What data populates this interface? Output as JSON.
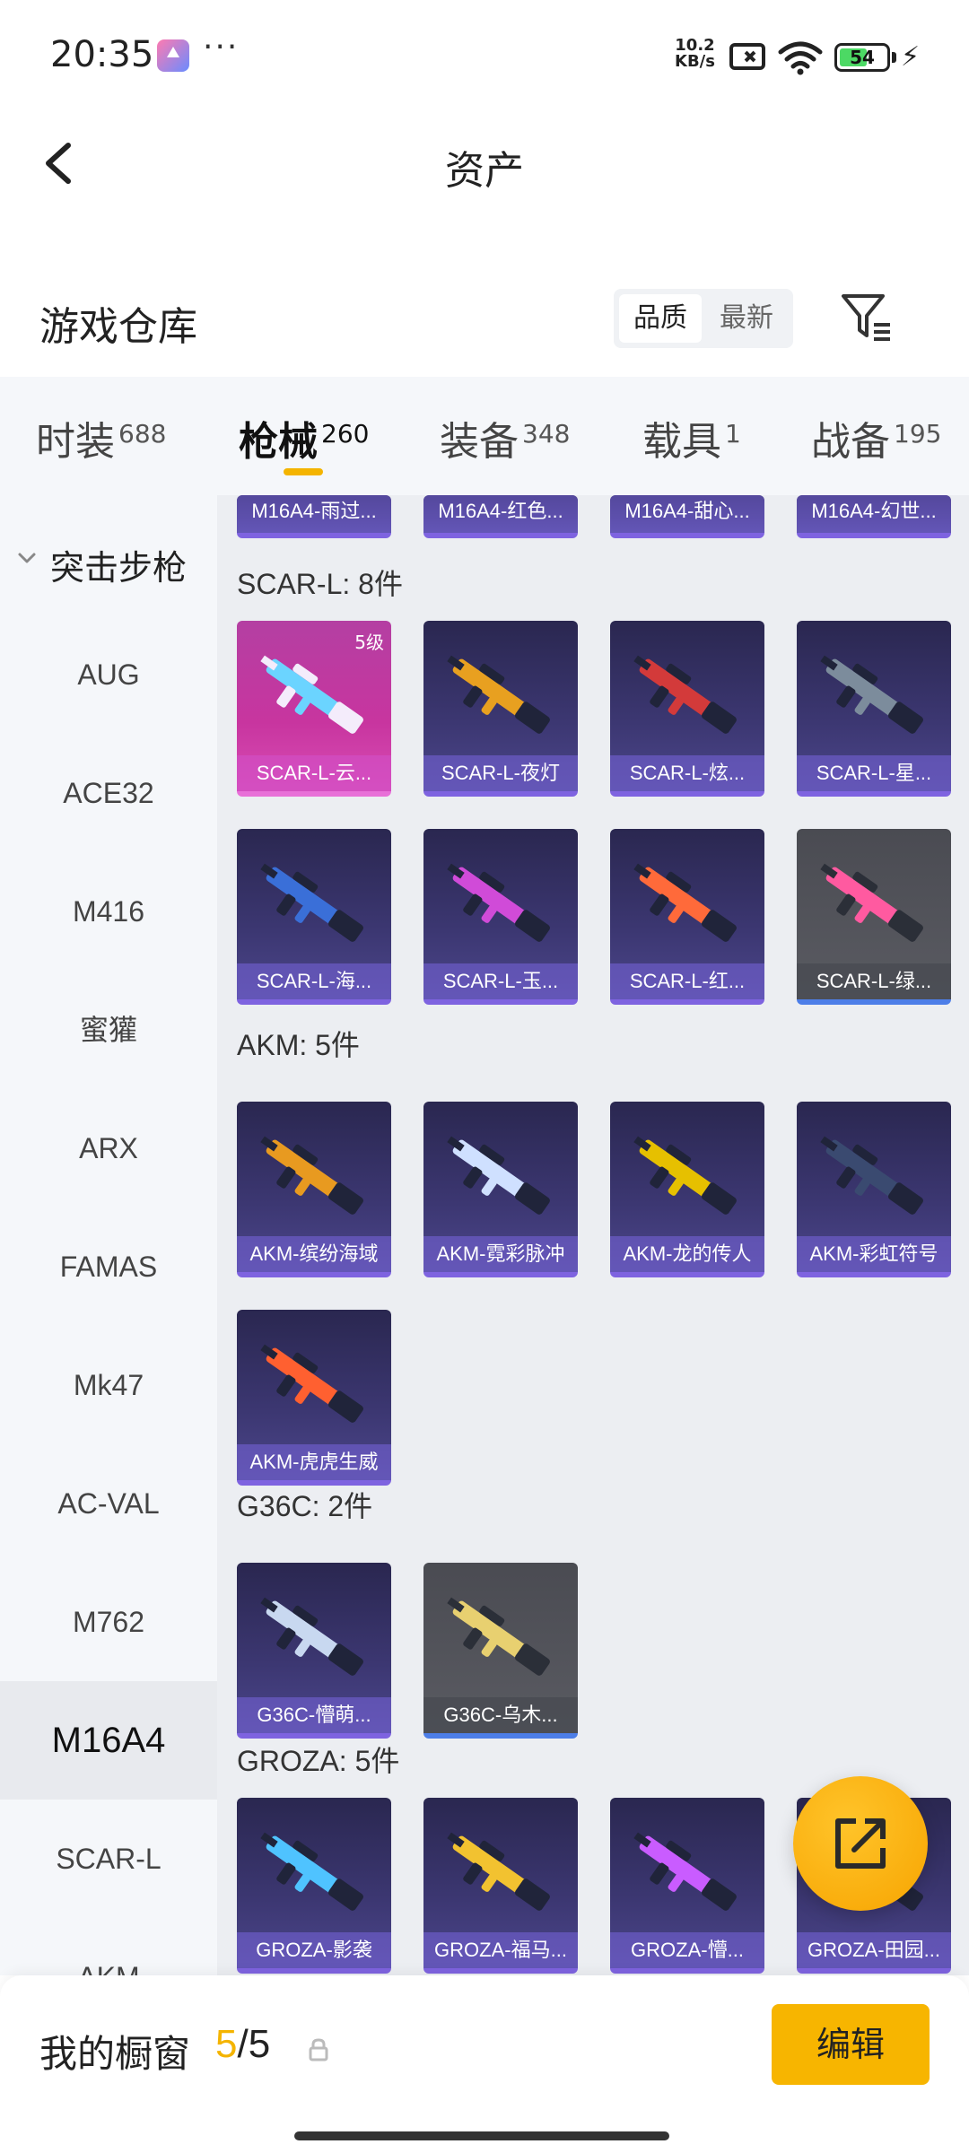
{
  "status_bar": {
    "time": "20:35",
    "dots": "···",
    "net_speed_value": "10.2",
    "net_speed_unit": "KB/s",
    "battery": "54"
  },
  "header": {
    "title": "资产"
  },
  "warehouse": {
    "title": "游戏仓库",
    "sort_options": [
      "品质",
      "最新"
    ]
  },
  "categories": [
    {
      "label": "时装",
      "count": "688"
    },
    {
      "label": "枪械",
      "count": "260"
    },
    {
      "label": "装备",
      "count": "348"
    },
    {
      "label": "载具",
      "count": "1"
    },
    {
      "label": "战备",
      "count": "195"
    }
  ],
  "sidebar": {
    "group": "突击步枪",
    "items": [
      "AUG",
      "ACE32",
      "M416",
      "蜜獾",
      "ARX",
      "FAMAS",
      "Mk47",
      "AC-VAL",
      "M762",
      "M16A4",
      "SCAR-L",
      "AKM"
    ],
    "active": "M16A4"
  },
  "sections": [
    {
      "title": "",
      "items": [
        {
          "name": "M16A4-雨过...",
          "style": "purple"
        },
        {
          "name": "M16A4-红色...",
          "style": "purple"
        },
        {
          "name": "M16A4-甜心...",
          "style": "purple"
        },
        {
          "name": "M16A4-幻世...",
          "style": "purple"
        }
      ]
    },
    {
      "title": "SCAR-L: 8件",
      "items": [
        {
          "name": "SCAR-L-云...",
          "style": "pink",
          "badge": "5级"
        },
        {
          "name": "SCAR-L-夜灯",
          "style": "purple"
        },
        {
          "name": "SCAR-L-炫...",
          "style": "purple"
        },
        {
          "name": "SCAR-L-星...",
          "style": "purple"
        },
        {
          "name": "SCAR-L-海...",
          "style": "purple"
        },
        {
          "name": "SCAR-L-玉...",
          "style": "purple"
        },
        {
          "name": "SCAR-L-红...",
          "style": "purple"
        },
        {
          "name": "SCAR-L-绿...",
          "style": "gray"
        }
      ]
    },
    {
      "title": "AKM: 5件",
      "items": [
        {
          "name": "AKM-缤纷海域",
          "style": "purple"
        },
        {
          "name": "AKM-霓彩脉冲",
          "style": "purple"
        },
        {
          "name": "AKM-龙的传人",
          "style": "purple"
        },
        {
          "name": "AKM-彩虹符号",
          "style": "purple"
        },
        {
          "name": "AKM-虎虎生威",
          "style": "purple"
        }
      ]
    },
    {
      "title": "G36C: 2件",
      "items": [
        {
          "name": "G36C-懵萌...",
          "style": "purple"
        },
        {
          "name": "G36C-乌木...",
          "style": "gray"
        }
      ]
    },
    {
      "title": "GROZA: 5件",
      "items": [
        {
          "name": "GROZA-影袭",
          "style": "purple"
        },
        {
          "name": "GROZA-福马...",
          "style": "purple"
        },
        {
          "name": "GROZA-懵...",
          "style": "purple"
        },
        {
          "name": "GROZA-田园...",
          "style": "purple"
        }
      ]
    }
  ],
  "showcase": {
    "label": "我的橱窗",
    "current": "5",
    "separator": "/",
    "max": "5",
    "edit_label": "编辑"
  },
  "colors": {
    "accent": "#f4b400",
    "card_purple": "#3c3772",
    "card_pink": "#c8359f",
    "card_gray": "#5a5b62"
  }
}
